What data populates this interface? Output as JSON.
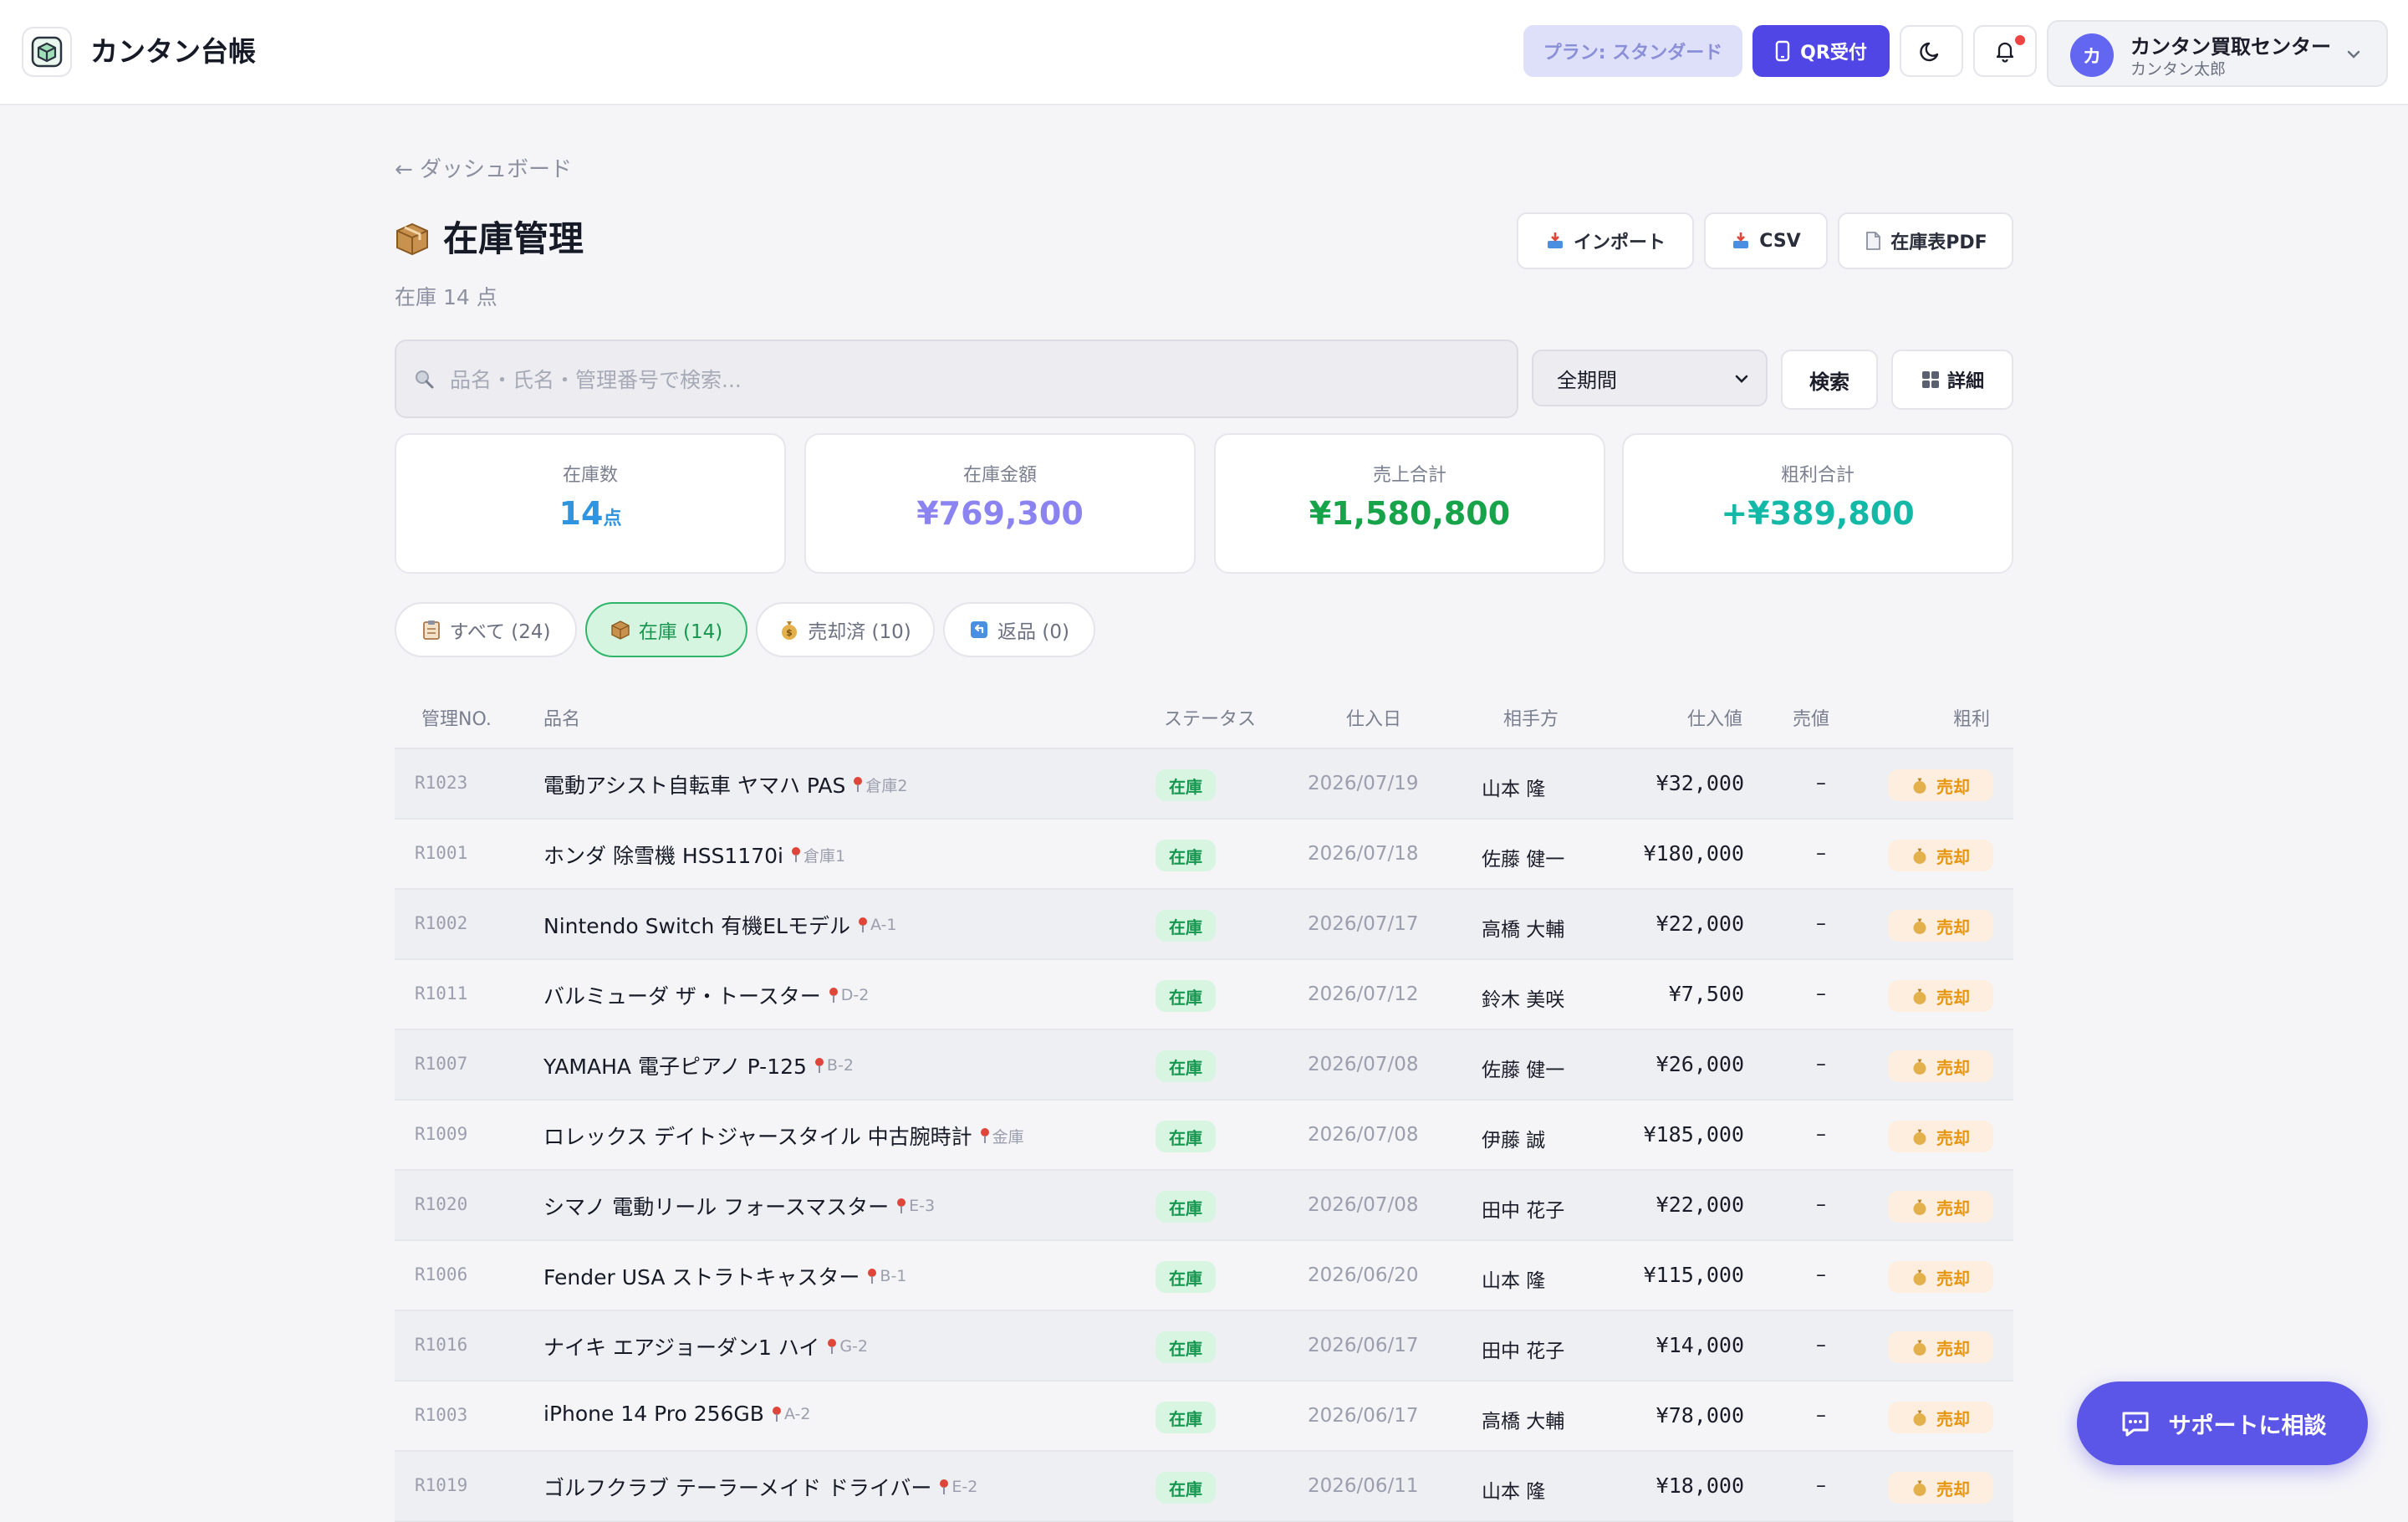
{
  "header": {
    "app_title": "カンタン台帳",
    "plan": "プラン: スタンダード",
    "qr_label": "QR受付",
    "account_name": "カンタン買取センター",
    "account_user": "カンタン太郎",
    "avatar_initial": "カ"
  },
  "page": {
    "back_label": "← ダッシュボード",
    "title": "在庫管理",
    "subtitle": "在庫 14 点",
    "import_label": "インポート",
    "csv_label": "CSV",
    "pdf_label": "在庫表PDF"
  },
  "search": {
    "placeholder": "品名・氏名・管理番号で検索...",
    "period_selected": "全期間",
    "search_label": "検索",
    "detail_label": "詳細"
  },
  "stats": [
    {
      "label": "在庫数",
      "value": "14",
      "unit": "点",
      "color": "#2f95e0"
    },
    {
      "label": "在庫金額",
      "value": "¥769,300",
      "unit": "",
      "color": "#8b84f0"
    },
    {
      "label": "売上合計",
      "value": "¥1,580,800",
      "unit": "",
      "color": "#16a34a"
    },
    {
      "label": "粗利合計",
      "value": "+¥389,800",
      "unit": "",
      "color": "#14b8a6"
    }
  ],
  "tabs": [
    {
      "label": "すべて (24)",
      "icon": "clipboard-icon"
    },
    {
      "label": "在庫 (14)",
      "icon": "box-icon"
    },
    {
      "label": "売却済 (10)",
      "icon": "money-bag-icon"
    },
    {
      "label": "返品 (0)",
      "icon": "return-icon"
    }
  ],
  "table": {
    "headers": {
      "id": "管理NO.",
      "name": "品名",
      "status": "ステータス",
      "date": "仕入日",
      "party": "相手方",
      "cost": "仕入値",
      "sale": "売値",
      "profit": "粗利"
    },
    "rows": [
      {
        "id": "R1023",
        "name": "電動アシスト自転車 ヤマハ PAS",
        "loc": "倉庫2",
        "status": "在庫",
        "date": "2026/07/19",
        "party": "山本 隆",
        "cost": "¥32,000",
        "sale": "–",
        "action": "売却"
      },
      {
        "id": "R1001",
        "name": "ホンダ 除雪機 HSS1170i",
        "loc": "倉庫1",
        "status": "在庫",
        "date": "2026/07/18",
        "party": "佐藤 健一",
        "cost": "¥180,000",
        "sale": "–",
        "action": "売却"
      },
      {
        "id": "R1002",
        "name": "Nintendo Switch 有機ELモデル",
        "loc": "A-1",
        "status": "在庫",
        "date": "2026/07/17",
        "party": "高橋 大輔",
        "cost": "¥22,000",
        "sale": "–",
        "action": "売却"
      },
      {
        "id": "R1011",
        "name": "バルミューダ ザ・トースター",
        "loc": "D-2",
        "status": "在庫",
        "date": "2026/07/12",
        "party": "鈴木 美咲",
        "cost": "¥7,500",
        "sale": "–",
        "action": "売却"
      },
      {
        "id": "R1007",
        "name": "YAMAHA 電子ピアノ P-125",
        "loc": "B-2",
        "status": "在庫",
        "date": "2026/07/08",
        "party": "佐藤 健一",
        "cost": "¥26,000",
        "sale": "–",
        "action": "売却"
      },
      {
        "id": "R1009",
        "name": "ロレックス デイトジャースタイル 中古腕時計",
        "loc": "金庫",
        "status": "在庫",
        "date": "2026/07/08",
        "party": "伊藤 誠",
        "cost": "¥185,000",
        "sale": "–",
        "action": "売却"
      },
      {
        "id": "R1020",
        "name": "シマノ 電動リール フォースマスター",
        "loc": "E-3",
        "status": "在庫",
        "date": "2026/07/08",
        "party": "田中 花子",
        "cost": "¥22,000",
        "sale": "–",
        "action": "売却"
      },
      {
        "id": "R1006",
        "name": "Fender USA ストラトキャスター",
        "loc": "B-1",
        "status": "在庫",
        "date": "2026/06/20",
        "party": "山本 隆",
        "cost": "¥115,000",
        "sale": "–",
        "action": "売却"
      },
      {
        "id": "R1016",
        "name": "ナイキ エアジョーダン1 ハイ",
        "loc": "G-2",
        "status": "在庫",
        "date": "2026/06/17",
        "party": "田中 花子",
        "cost": "¥14,000",
        "sale": "–",
        "action": "売却"
      },
      {
        "id": "R1003",
        "name": "iPhone 14 Pro 256GB",
        "loc": "A-2",
        "status": "在庫",
        "date": "2026/06/17",
        "party": "高橋 大輔",
        "cost": "¥78,000",
        "sale": "–",
        "action": "売却"
      },
      {
        "id": "R1019",
        "name": "ゴルフクラブ テーラーメイド ドライバー",
        "loc": "E-2",
        "status": "在庫",
        "date": "2026/06/11",
        "party": "山本 隆",
        "cost": "¥18,000",
        "sale": "–",
        "action": "売却"
      }
    ]
  },
  "support": {
    "label": "サポートに相談"
  }
}
